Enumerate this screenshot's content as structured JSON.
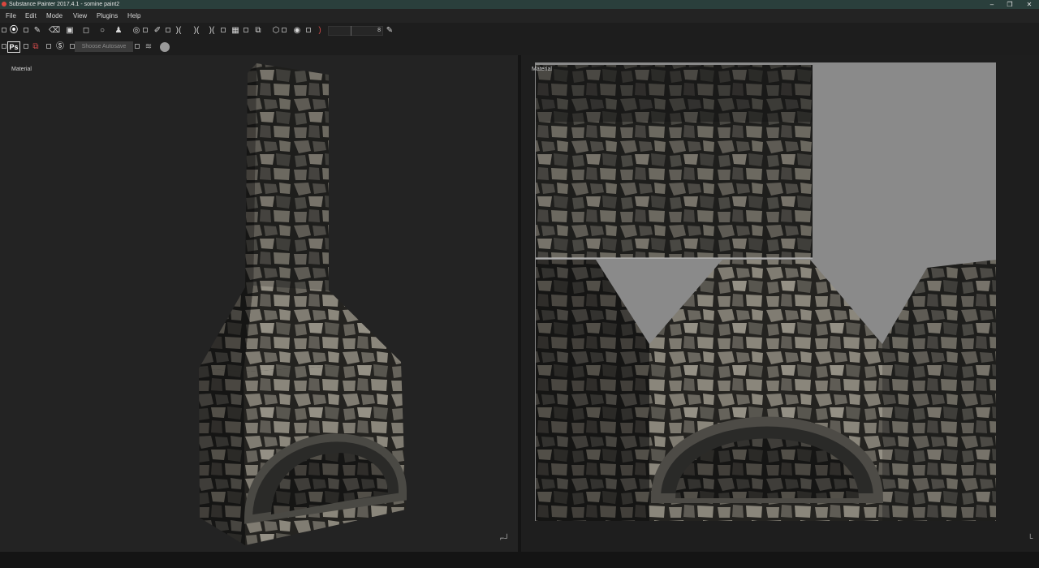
{
  "window": {
    "title": "Substance Painter 2017.4.1 - somine paint2",
    "controls": [
      "minimize-icon",
      "restore-icon",
      "close-icon"
    ]
  },
  "menu": {
    "items": [
      "File",
      "Edit",
      "Mode",
      "View",
      "Plugins",
      "Help"
    ]
  },
  "toolbar": {
    "slider_value": "8",
    "photoshop_label": "Ps",
    "autosave_tooltip": "Shoose Autosave",
    "icons": [
      "substance-logo-icon",
      "brush-icon",
      "eraser-icon",
      "projection-icon",
      "polygon-fill-icon",
      "smudge-icon",
      "clone-icon",
      "material-picker-icon",
      "color-picker-icon",
      "symmetry-icon",
      "camera-icon",
      "render-icon",
      "screenshot-icon"
    ]
  },
  "viewports": {
    "left_label": "Material",
    "right_label": "Material"
  },
  "colors": {
    "titlebar": "#2a3f3c",
    "menubar": "#232323",
    "viewport": "#232323",
    "uv_background": "#8a8a8a",
    "stone_dark": "#2d2d2a",
    "stone_light": "#6f6c63"
  }
}
